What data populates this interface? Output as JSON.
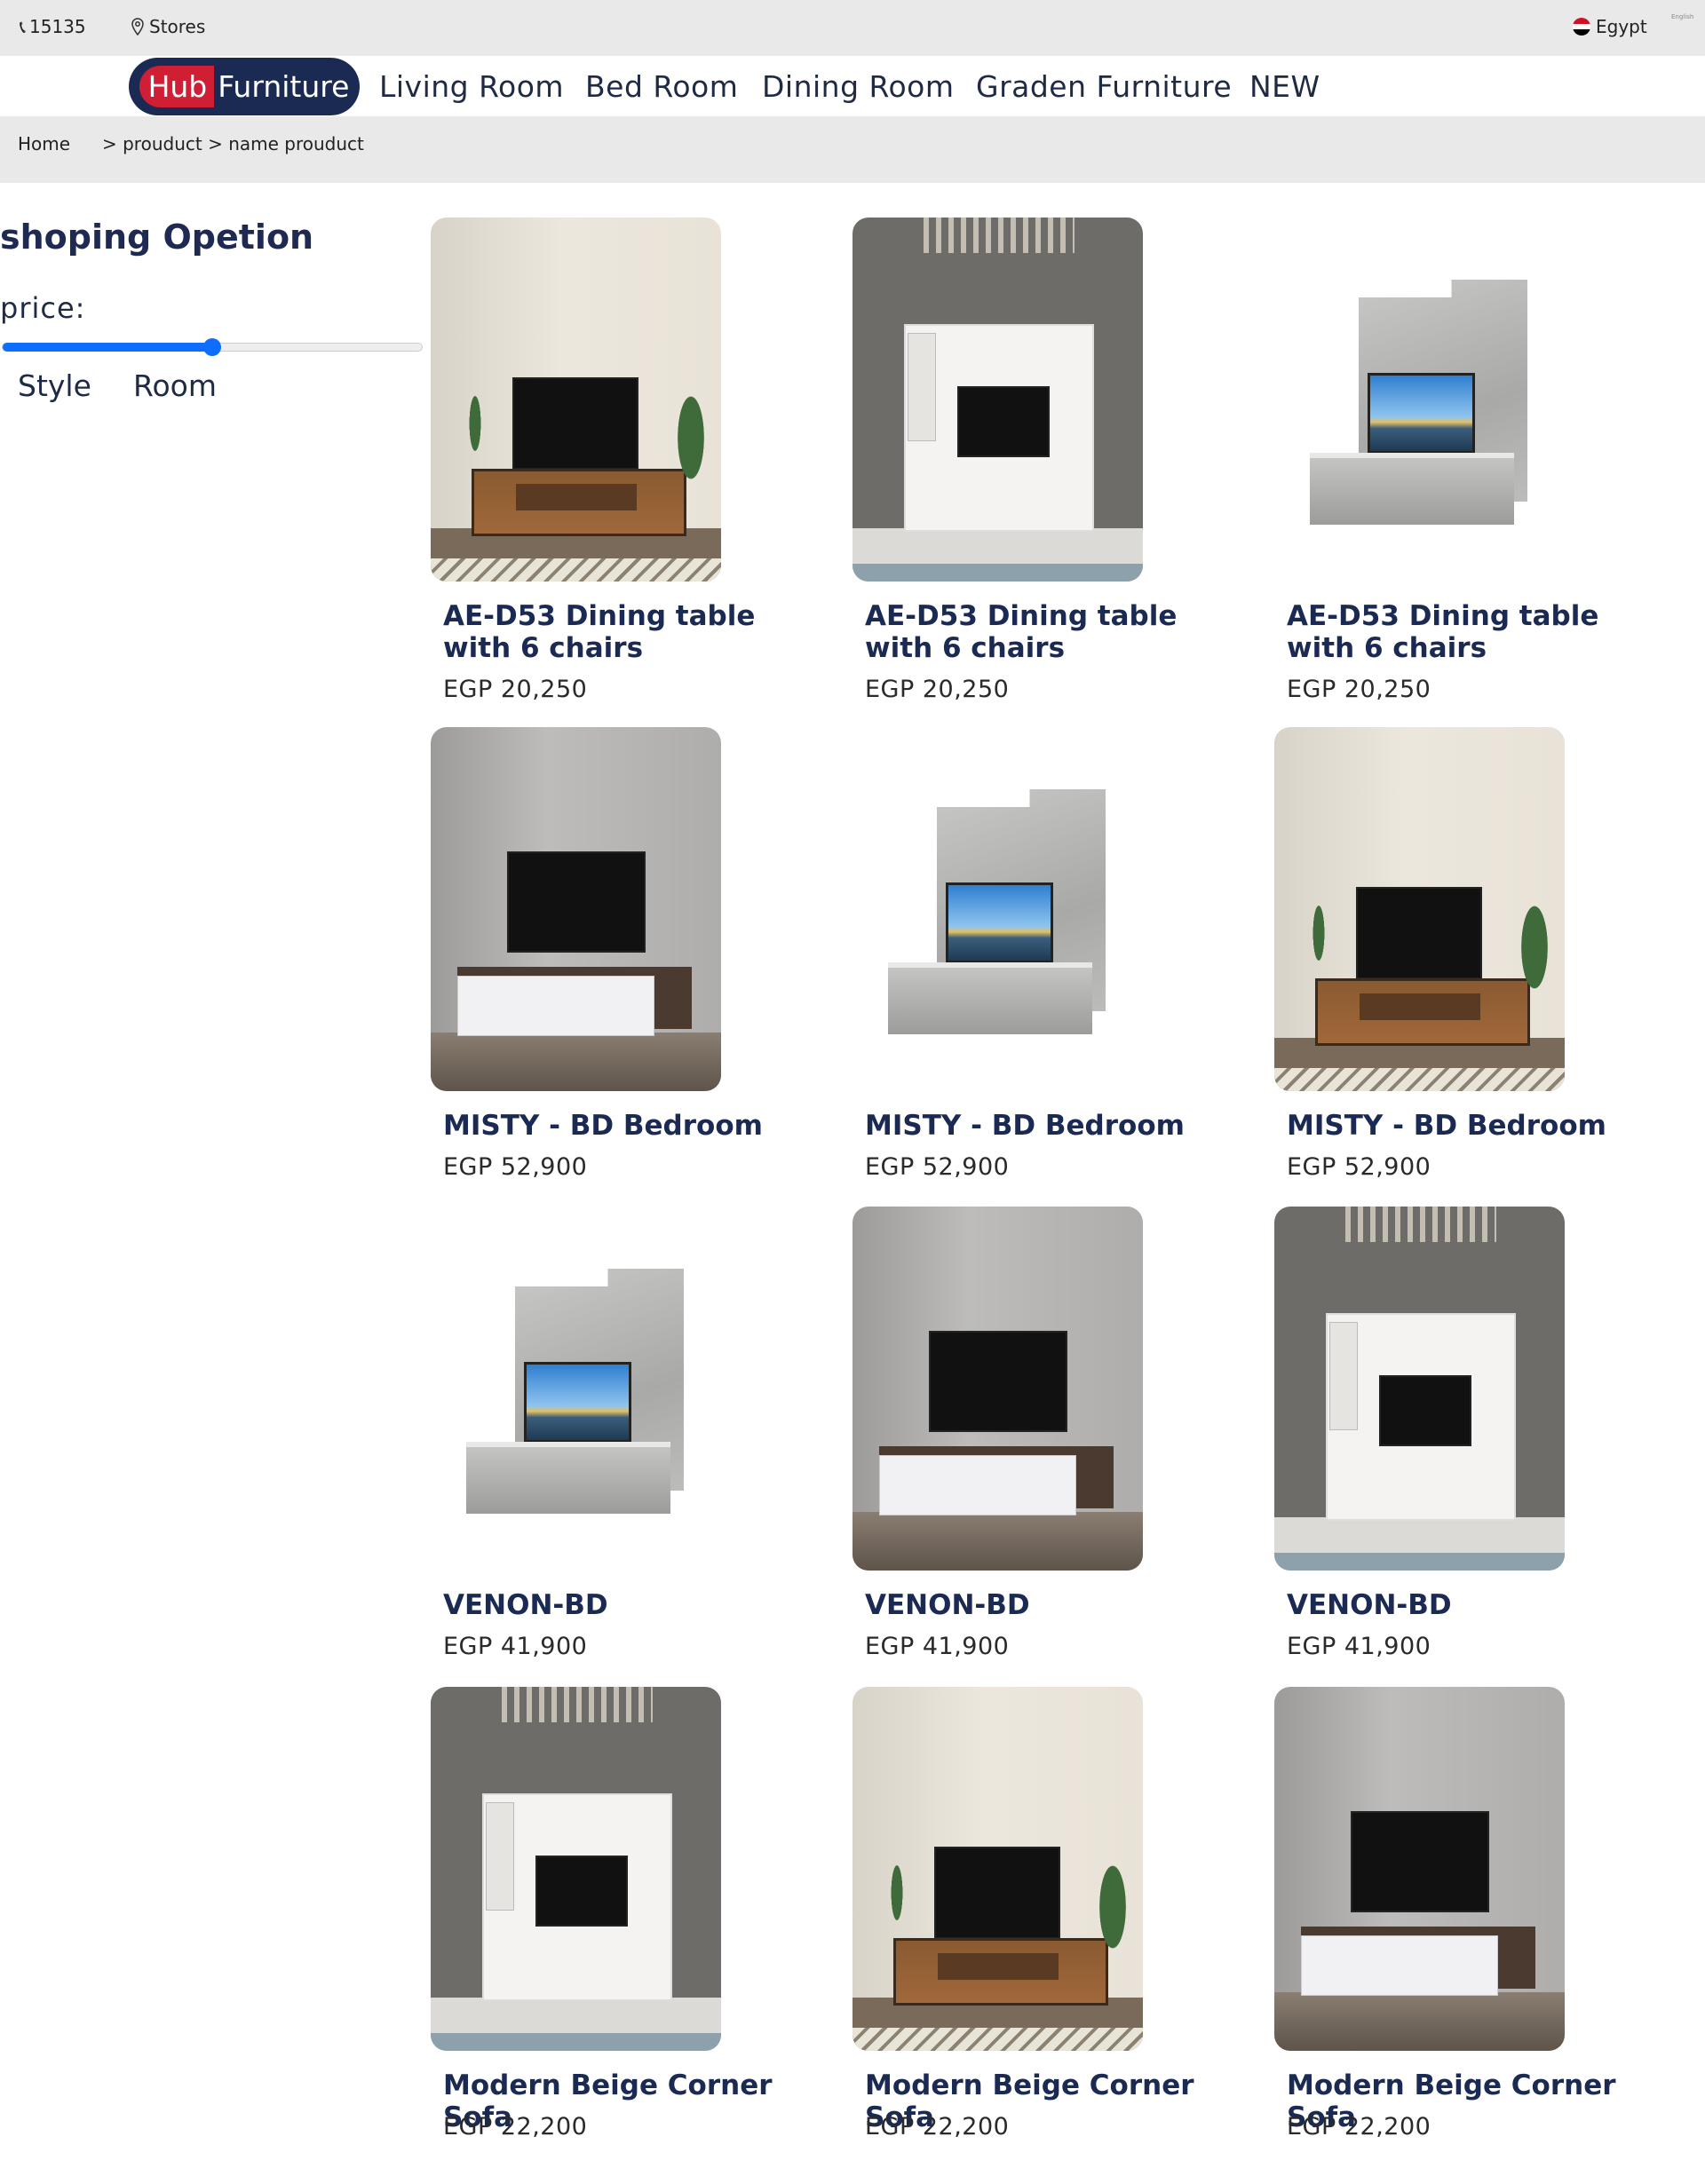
{
  "topbar": {
    "phone": "15135",
    "stores": "Stores",
    "country": "Egypt",
    "language": "English"
  },
  "nav": {
    "logo_hub": "Hub",
    "logo_furniture": "Furniture",
    "links": [
      "Living Room",
      "Bed Room",
      "Dining Room",
      "Graden Furniture",
      "NEW"
    ]
  },
  "breadcrumb": {
    "home": "Home",
    "path": "> prouduct > name prouduct"
  },
  "sidebar": {
    "title": "shoping Opetion",
    "price_label": "price:",
    "price_slider_value_percent": 50,
    "tabs": [
      "Style",
      "Room"
    ]
  },
  "products": [
    {
      "name": "AE-D53 Dining table with 6 chairs",
      "price": "EGP 20,250",
      "scene": "wood-beige"
    },
    {
      "name": "AE-D53 Dining table with 6 chairs",
      "price": "EGP 20,250",
      "scene": "white-dark"
    },
    {
      "name": "AE-D53 Dining table with 6 chairs",
      "price": "EGP 20,250",
      "scene": "grey-cut"
    },
    {
      "name": "MISTY - BD Bedroom",
      "price": "EGP 52,900",
      "scene": "white-grey"
    },
    {
      "name": "MISTY - BD Bedroom",
      "price": "EGP 52,900",
      "scene": "grey-cut"
    },
    {
      "name": "MISTY - BD Bedroom",
      "price": "EGP 52,900",
      "scene": "wood-beige"
    },
    {
      "name": "VENON-BD",
      "price": "EGP 41,900",
      "scene": "grey-cut"
    },
    {
      "name": "VENON-BD",
      "price": "EGP 41,900",
      "scene": "white-grey"
    },
    {
      "name": "VENON-BD",
      "price": "EGP 41,900",
      "scene": "white-dark"
    },
    {
      "name": "Modern Beige Corner Sofa",
      "price": "EGP 22,200",
      "scene": "white-dark"
    },
    {
      "name": "Modern Beige Corner Sofa",
      "price": "EGP 22,200",
      "scene": "wood-beige"
    },
    {
      "name": "Modern Beige Corner Sofa",
      "price": "EGP 22,200",
      "scene": "white-grey"
    }
  ],
  "colors": {
    "navy": "#1b2a52",
    "logo_red": "#d01f35",
    "slider_blue": "#0d6efd",
    "bar_grey": "#e9e9e9"
  }
}
